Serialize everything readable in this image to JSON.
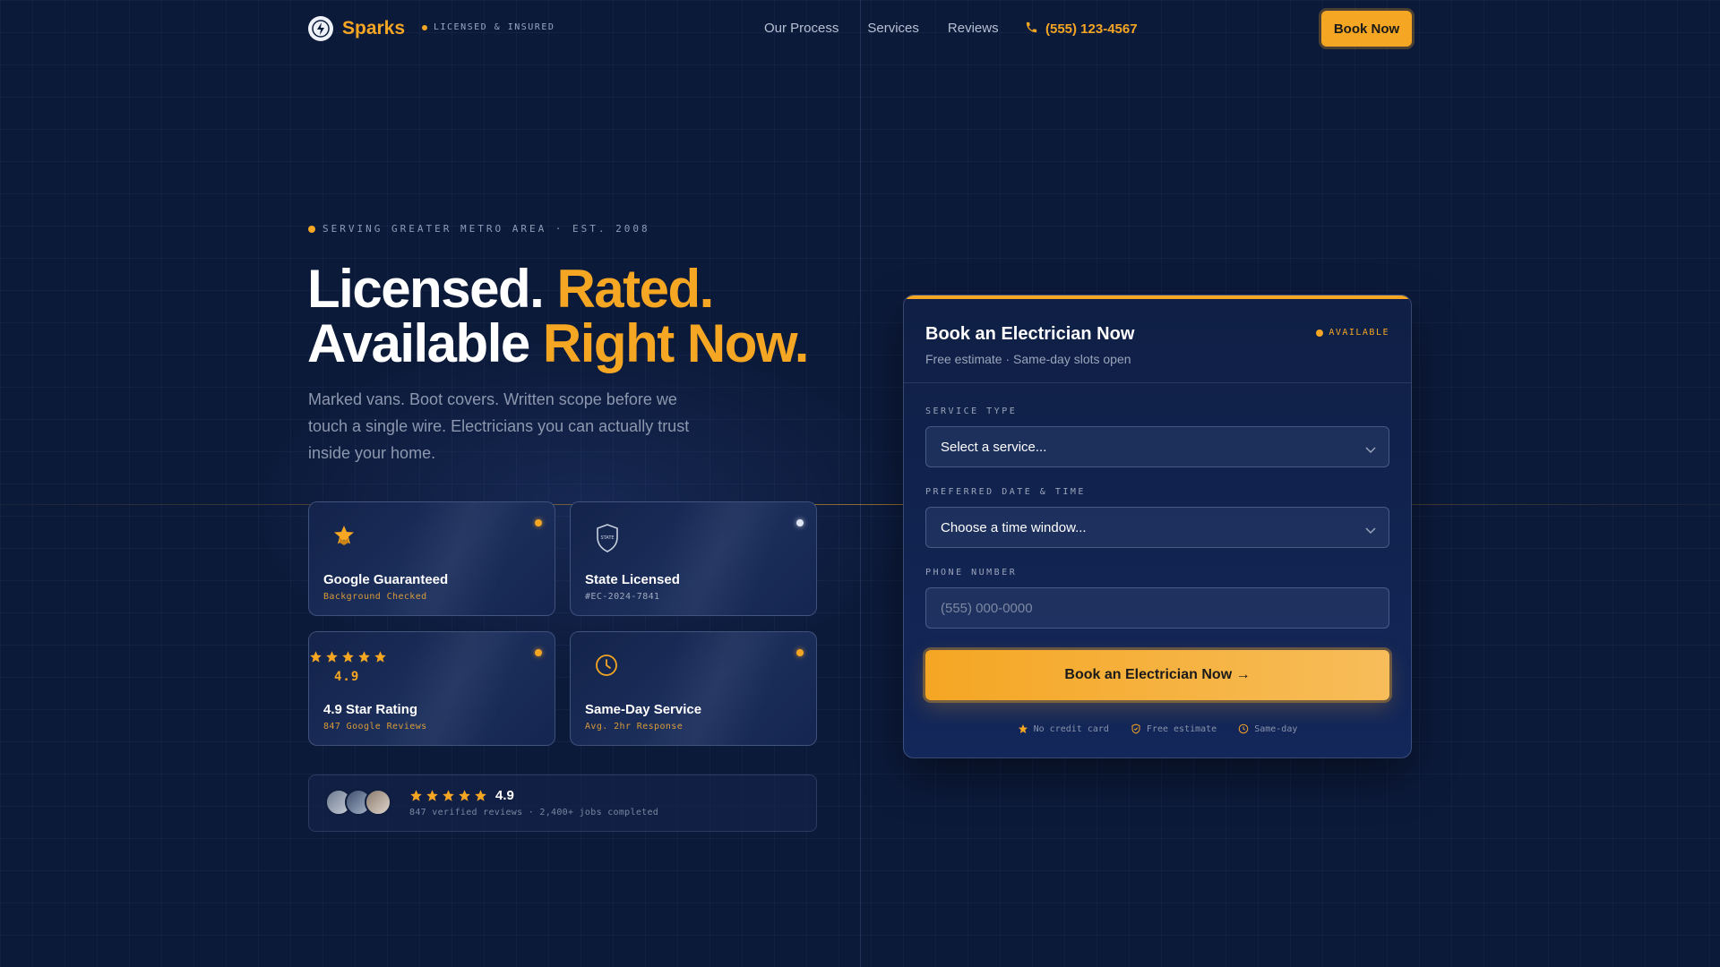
{
  "nav": {
    "brand_name": "Sparks",
    "badge": "LICENSED & INSURED",
    "links": [
      "Our Process",
      "Services",
      "Reviews"
    ],
    "phone": "(555) 123-4567",
    "book_label": "Book Now"
  },
  "hero": {
    "eyebrow": "SERVING GREATER METRO AREA · EST. 2008",
    "title_line1_a": "Licensed.",
    "title_line1_b": "Rated.",
    "title_line2_a": "Available",
    "title_line2_b": "Right Now.",
    "subtitle": "Marked vans. Boot covers. Written scope before we touch a single wire. Electricians you can actually trust inside your home."
  },
  "cards": [
    {
      "title": "Google Guaranteed",
      "sub": "Background Checked",
      "icon": "badge-star-icon"
    },
    {
      "title": "State Licensed",
      "sub": "#EC-2024-7841",
      "icon": "shield-icon",
      "shield_text": "STATE"
    },
    {
      "title": "4.9 Star Rating",
      "sub": "847 Google Reviews",
      "rating": "4.9",
      "stars": 5,
      "icon": "star-icon"
    },
    {
      "title": "Same-Day Service",
      "sub": "Avg. 2hr Response",
      "icon": "clock-icon"
    }
  ],
  "reviews": {
    "score": "4.9",
    "stars": 5,
    "summary": "847 verified reviews · 2,400+ jobs completed"
  },
  "booking": {
    "title": "Book an Electrician Now",
    "subtitle": "Free estimate · Same-day slots open",
    "status": "AVAILABLE",
    "service_label": "SERVICE TYPE",
    "service_value": "Select a service...",
    "date_label": "PREFERRED DATE & TIME",
    "date_value": "Choose a time window...",
    "phone_label": "PHONE NUMBER",
    "phone_placeholder": "(555) 000-0000",
    "cta": "Book an Electrician Now →",
    "trust": [
      "No credit card",
      "Free estimate",
      "Same-day"
    ]
  },
  "colors": {
    "background": "#0c1a3a",
    "accent": "#f5a623",
    "text": "#ffffff",
    "muted": "#8d97ae"
  }
}
